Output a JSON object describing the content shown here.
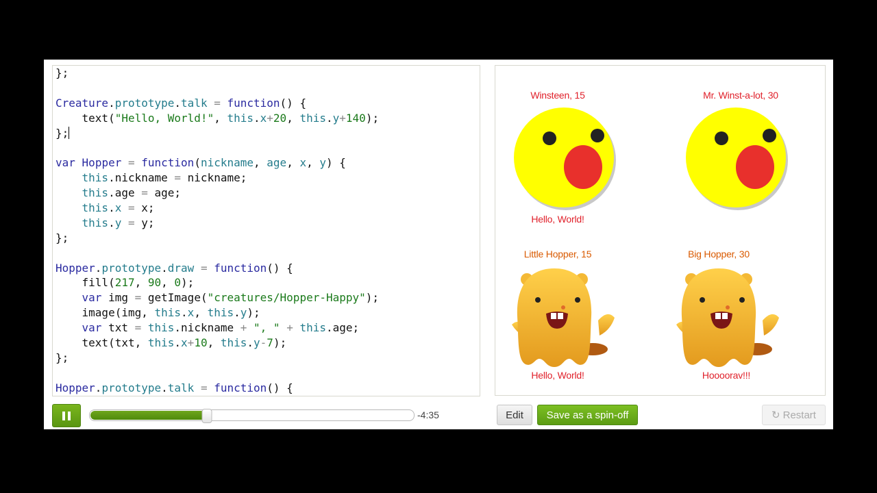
{
  "editor": {
    "lines": [
      [
        [
          "txt",
          "};"
        ]
      ],
      [],
      [
        [
          "ident",
          "Creature"
        ],
        [
          "txt",
          "."
        ],
        [
          "prop",
          "prototype"
        ],
        [
          "txt",
          "."
        ],
        [
          "prop",
          "talk"
        ],
        [
          "op",
          " = "
        ],
        [
          "kw",
          "function"
        ],
        [
          "txt",
          "() {"
        ]
      ],
      [
        [
          "txt",
          "    text("
        ],
        [
          "str",
          "\"Hello, World!\""
        ],
        [
          "txt",
          ", "
        ],
        [
          "this",
          "this"
        ],
        [
          "txt",
          "."
        ],
        [
          "prop",
          "x"
        ],
        [
          "op",
          "+"
        ],
        [
          "num",
          "20"
        ],
        [
          "txt",
          ", "
        ],
        [
          "this",
          "this"
        ],
        [
          "txt",
          "."
        ],
        [
          "prop",
          "y"
        ],
        [
          "op",
          "+"
        ],
        [
          "num",
          "140"
        ],
        [
          "txt",
          ");"
        ]
      ],
      [
        [
          "txt",
          "};"
        ],
        [
          "cursor",
          ""
        ]
      ],
      [],
      [
        [
          "kw",
          "var"
        ],
        [
          "txt",
          " "
        ],
        [
          "ident",
          "Hopper"
        ],
        [
          "op",
          " = "
        ],
        [
          "kw",
          "function"
        ],
        [
          "txt",
          "("
        ],
        [
          "prop",
          "nickname"
        ],
        [
          "txt",
          ", "
        ],
        [
          "prop",
          "age"
        ],
        [
          "txt",
          ", "
        ],
        [
          "prop",
          "x"
        ],
        [
          "txt",
          ", "
        ],
        [
          "prop",
          "y"
        ],
        [
          "txt",
          ") {"
        ]
      ],
      [
        [
          "txt",
          "    "
        ],
        [
          "this",
          "this"
        ],
        [
          "txt",
          ".nickname "
        ],
        [
          "op",
          "="
        ],
        [
          "txt",
          " nickname;"
        ]
      ],
      [
        [
          "txt",
          "    "
        ],
        [
          "this",
          "this"
        ],
        [
          "txt",
          ".age "
        ],
        [
          "op",
          "="
        ],
        [
          "txt",
          " age;"
        ]
      ],
      [
        [
          "txt",
          "    "
        ],
        [
          "this",
          "this"
        ],
        [
          "txt",
          "."
        ],
        [
          "prop",
          "x"
        ],
        [
          "op",
          " = "
        ],
        [
          "txt",
          "x;"
        ]
      ],
      [
        [
          "txt",
          "    "
        ],
        [
          "this",
          "this"
        ],
        [
          "txt",
          "."
        ],
        [
          "prop",
          "y"
        ],
        [
          "op",
          " = "
        ],
        [
          "txt",
          "y;"
        ]
      ],
      [
        [
          "txt",
          "};"
        ]
      ],
      [],
      [
        [
          "ident",
          "Hopper"
        ],
        [
          "txt",
          "."
        ],
        [
          "prop",
          "prototype"
        ],
        [
          "txt",
          "."
        ],
        [
          "prop",
          "draw"
        ],
        [
          "op",
          " = "
        ],
        [
          "kw",
          "function"
        ],
        [
          "txt",
          "() {"
        ]
      ],
      [
        [
          "txt",
          "    fill("
        ],
        [
          "num",
          "217"
        ],
        [
          "txt",
          ", "
        ],
        [
          "num",
          "90"
        ],
        [
          "txt",
          ", "
        ],
        [
          "num",
          "0"
        ],
        [
          "txt",
          ");"
        ]
      ],
      [
        [
          "txt",
          "    "
        ],
        [
          "kw",
          "var"
        ],
        [
          "txt",
          " img "
        ],
        [
          "op",
          "="
        ],
        [
          "txt",
          " getImage("
        ],
        [
          "str",
          "\"creatures/Hopper-Happy\""
        ],
        [
          "txt",
          ");"
        ]
      ],
      [
        [
          "txt",
          "    image(img, "
        ],
        [
          "this",
          "this"
        ],
        [
          "txt",
          "."
        ],
        [
          "prop",
          "x"
        ],
        [
          "txt",
          ", "
        ],
        [
          "this",
          "this"
        ],
        [
          "txt",
          "."
        ],
        [
          "prop",
          "y"
        ],
        [
          "txt",
          ");"
        ]
      ],
      [
        [
          "txt",
          "    "
        ],
        [
          "kw",
          "var"
        ],
        [
          "txt",
          " txt "
        ],
        [
          "op",
          "="
        ],
        [
          "txt",
          " "
        ],
        [
          "this",
          "this"
        ],
        [
          "txt",
          ".nickname "
        ],
        [
          "op",
          "+"
        ],
        [
          "txt",
          " "
        ],
        [
          "str",
          "\", \""
        ],
        [
          "txt",
          " "
        ],
        [
          "op",
          "+"
        ],
        [
          "txt",
          " "
        ],
        [
          "this",
          "this"
        ],
        [
          "txt",
          ".age;"
        ]
      ],
      [
        [
          "txt",
          "    text(txt, "
        ],
        [
          "this",
          "this"
        ],
        [
          "txt",
          "."
        ],
        [
          "prop",
          "x"
        ],
        [
          "op",
          "+"
        ],
        [
          "num",
          "10"
        ],
        [
          "txt",
          ", "
        ],
        [
          "this",
          "this"
        ],
        [
          "txt",
          "."
        ],
        [
          "prop",
          "y"
        ],
        [
          "op",
          "-"
        ],
        [
          "num",
          "7"
        ],
        [
          "txt",
          ");"
        ]
      ],
      [
        [
          "txt",
          "};"
        ]
      ],
      [],
      [
        [
          "ident",
          "Hopper"
        ],
        [
          "txt",
          "."
        ],
        [
          "prop",
          "prototype"
        ],
        [
          "txt",
          "."
        ],
        [
          "prop",
          "talk"
        ],
        [
          "op",
          " = "
        ],
        [
          "kw",
          "function"
        ],
        [
          "txt",
          "() {"
        ]
      ]
    ]
  },
  "output": {
    "creature1": {
      "name_label": "Winsteen, 15",
      "speech": "Hello, World!"
    },
    "creature2": {
      "name_label": "Mr. Winst-a-lot, 30"
    },
    "hopper1": {
      "name_label": "Little Hopper, 15",
      "speech": "Hello, World!"
    },
    "hopper2": {
      "name_label": "Big Hopper, 30",
      "speech": "Hoooorav!!!"
    }
  },
  "player": {
    "progress": 0.36,
    "time_remaining": "-4:35",
    "pause_icon": "pause-icon"
  },
  "buttons": {
    "edit": "Edit",
    "spinoff": "Save as a spin-off",
    "restart": "Restart",
    "restart_icon": "refresh-icon"
  },
  "colors": {
    "accent_green": "#6aa81a",
    "label_red": "#e0202a",
    "label_orange": "#d95a00",
    "creature_yellow": "#ffff00",
    "mouth_red": "#e8302c"
  }
}
